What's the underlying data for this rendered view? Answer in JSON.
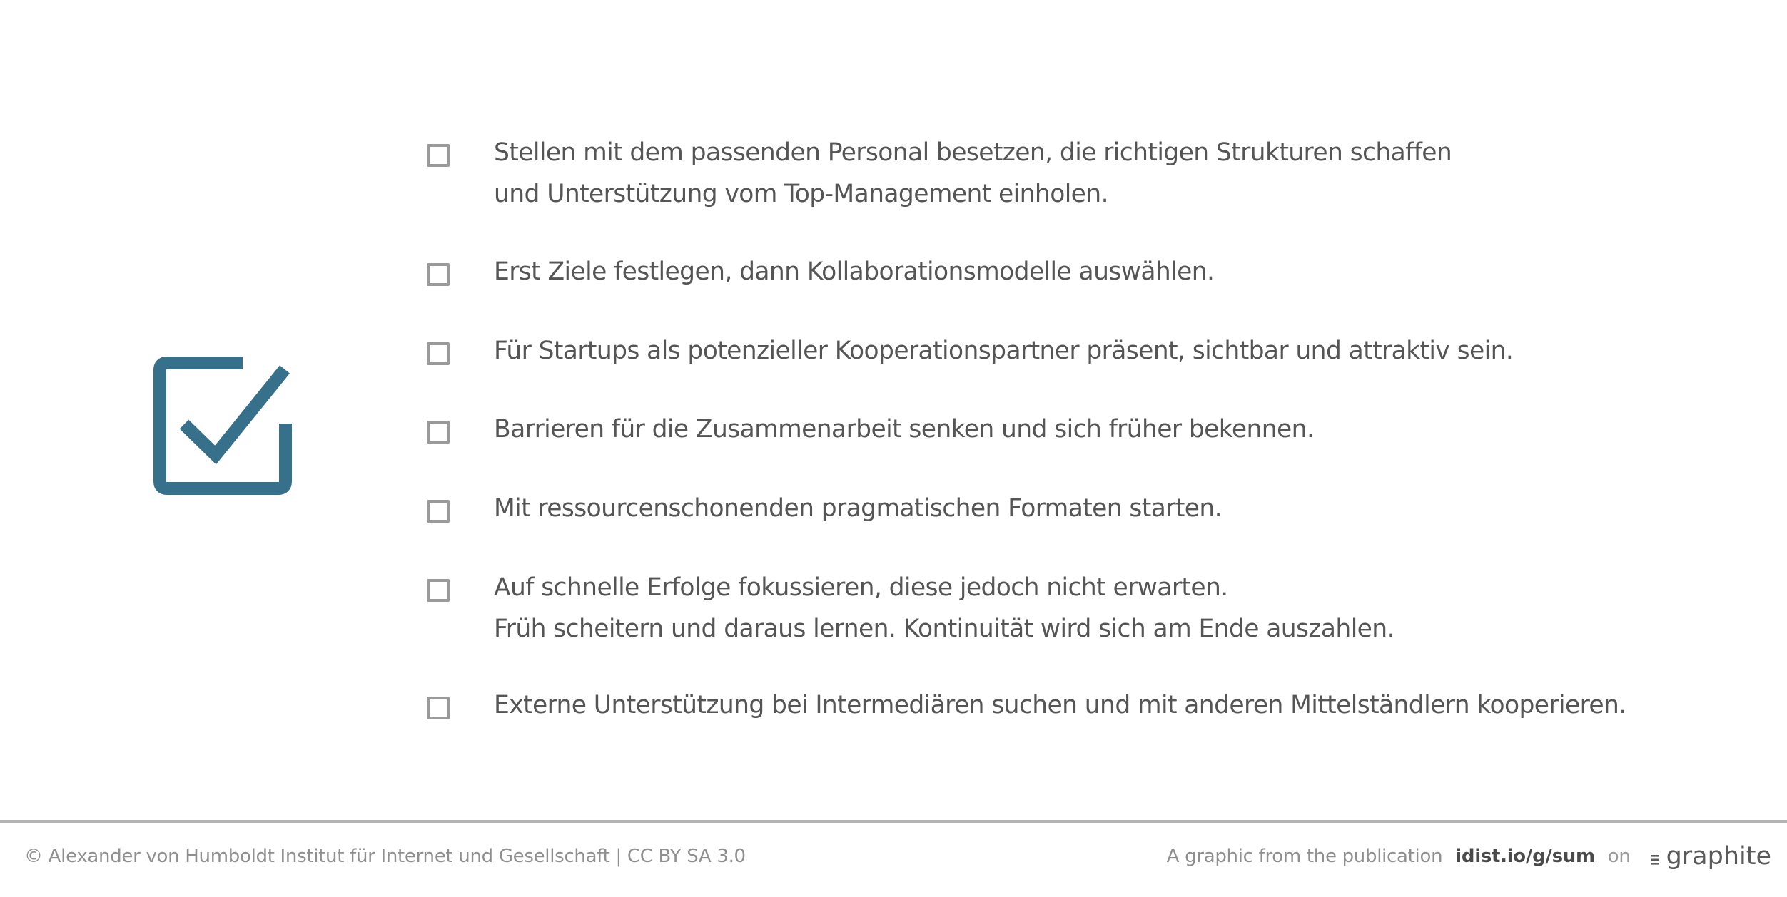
{
  "hero": {
    "icon": "checked-checkbox-icon",
    "color": "#36708a"
  },
  "checklist": {
    "items": [
      {
        "checked": false,
        "lines": [
          "Stellen mit dem passenden Personal besetzen, die richtigen Strukturen schaffen",
          "und Unterstützung vom Top-Management einholen."
        ]
      },
      {
        "checked": false,
        "lines": [
          "Erst Ziele festlegen, dann Kollaborationsmodelle auswählen."
        ]
      },
      {
        "checked": false,
        "lines": [
          "Für Startups als potenzieller Kooperationspartner präsent, sichtbar und attraktiv sein."
        ]
      },
      {
        "checked": false,
        "lines": [
          "Barrieren für die Zusammenarbeit senken und sich früher bekennen."
        ]
      },
      {
        "checked": false,
        "lines": [
          "Mit ressourcenschonenden pragmatischen Formaten starten."
        ]
      },
      {
        "checked": false,
        "lines": [
          "Auf schnelle Erfolge fokussieren, diese jedoch nicht erwarten.",
          "Früh scheitern und daraus lernen. Kontinuität wird sich am Ende auszahlen."
        ]
      },
      {
        "checked": false,
        "lines": [
          "Externe Unterstützung bei Intermediären suchen und mit anderen Mittelständlern kooperieren."
        ]
      }
    ]
  },
  "footer": {
    "copyright": "© Alexander von Humboldt Institut für Internet und Gesellschaft | CC BY SA 3.0",
    "publication_prefix": "A graphic from the publication",
    "publication_link": "idist.io/g/sum",
    "on_label": "on",
    "brand": "graphite",
    "brand_icon": "graphite-logo-icon"
  }
}
